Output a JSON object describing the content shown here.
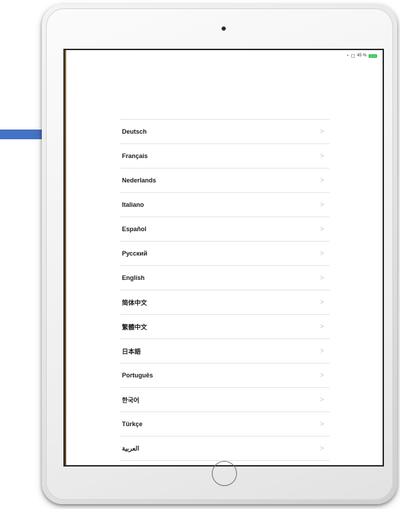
{
  "status_bar": {
    "battery_text": "45 %",
    "wifi_icon": "wifi-icon",
    "orientation_icon": "orientation-lock-icon",
    "battery_color": "#4cd964"
  },
  "languages": [
    {
      "label": "Deutsch"
    },
    {
      "label": "Français"
    },
    {
      "label": "Nederlands"
    },
    {
      "label": "Italiano"
    },
    {
      "label": "Español"
    },
    {
      "label": "Русский"
    },
    {
      "label": "English"
    },
    {
      "label": "简体中文"
    },
    {
      "label": "繁體中文"
    },
    {
      "label": "日本語"
    },
    {
      "label": "Português"
    },
    {
      "label": "한국어"
    },
    {
      "label": "Türkçe"
    },
    {
      "label": "العربية"
    }
  ],
  "chevron_glyph": ">",
  "arrow_color": "#4472c4"
}
